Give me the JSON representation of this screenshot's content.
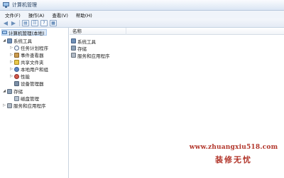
{
  "window": {
    "title": "计算机管理"
  },
  "menu": [
    {
      "label": "文件(F)"
    },
    {
      "label": "操作(A)"
    },
    {
      "label": "查看(V)"
    },
    {
      "label": "帮助(H)"
    }
  ],
  "toolbar": {
    "back_icon": "back-arrow-icon",
    "forward_icon": "forward-arrow-icon",
    "buttons": [
      "show-hide-tree-icon",
      "properties-icon",
      "help-icon",
      "view-icon"
    ],
    "help_glyph": "?"
  },
  "tree": {
    "root": "计算机管理(本地)",
    "system_tools": "系统工具",
    "task_scheduler": "任务计划程序",
    "event_viewer": "事件查看器",
    "shared_folders": "共享文件夹",
    "local_users": "本地用户和组",
    "performance": "性能",
    "device_manager": "设备管理器",
    "storage": "存储",
    "disk_management": "磁盘管理",
    "services_apps": "服务和应用程序"
  },
  "list": {
    "header_name": "名称",
    "rows": [
      {
        "label": "系统工具",
        "icon": "tools-icon"
      },
      {
        "label": "存储",
        "icon": "storage-icon"
      },
      {
        "label": "服务和应用程序",
        "icon": "services-icon"
      }
    ]
  },
  "watermark": {
    "url": "www.zhuangxiu518.com",
    "name": "装修无忧"
  },
  "colors": {
    "accent": "#1e395b",
    "selection": "#dce9f8",
    "watermark": "#b2362b"
  }
}
